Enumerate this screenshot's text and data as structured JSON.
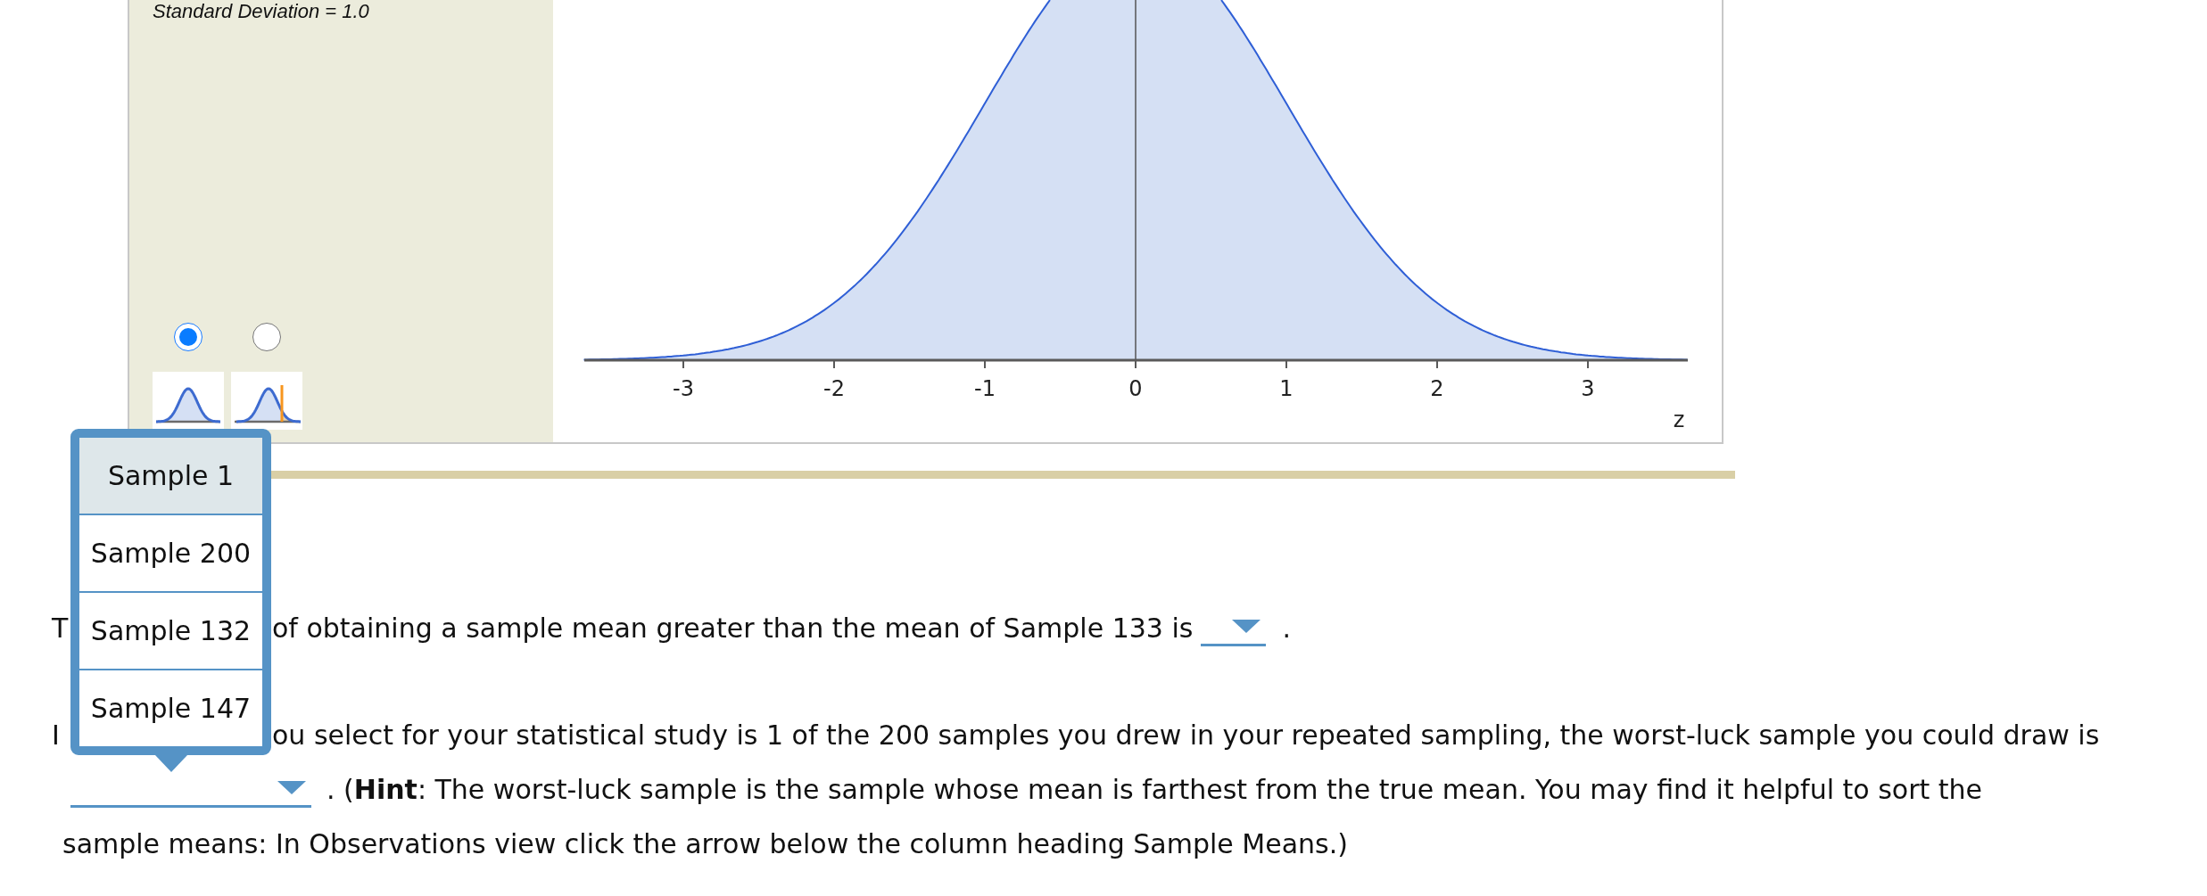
{
  "distribution_panel": {
    "parameter_label": "Standard Deviation = 1.0",
    "curve_options": [
      {
        "kind": "plain",
        "selected": true
      },
      {
        "kind": "shaded_tail",
        "selected": false
      }
    ]
  },
  "plot": {
    "tick_labels": [
      "-3",
      "-2",
      "-1",
      "0",
      "1",
      "2",
      "3"
    ],
    "axis_label": "z"
  },
  "questions": [
    {
      "lead": "T",
      "text": "of obtaining a sample mean greater than the mean of Sample 133 is",
      "after": "."
    },
    {
      "lead": "I",
      "text": "ou select for your statistical study is 1 of the 200 samples you drew in your repeated sampling, the worst-luck sample you could draw is",
      "menu_options": [
        {
          "label": "Sample 1",
          "selected": true
        },
        {
          "label": "Sample 200",
          "selected": false
        },
        {
          "label": "Sample 132",
          "selected": false
        },
        {
          "label": "Sample 147",
          "selected": false
        }
      ],
      "after": ". (**Hint**: The worst-luck sample is the sample whose mean is farthest from the true mean. You may find it helpful to sort the",
      "continuation": "sample means: In Observations view click the arrow below the column heading Sample Means.)"
    }
  ]
}
